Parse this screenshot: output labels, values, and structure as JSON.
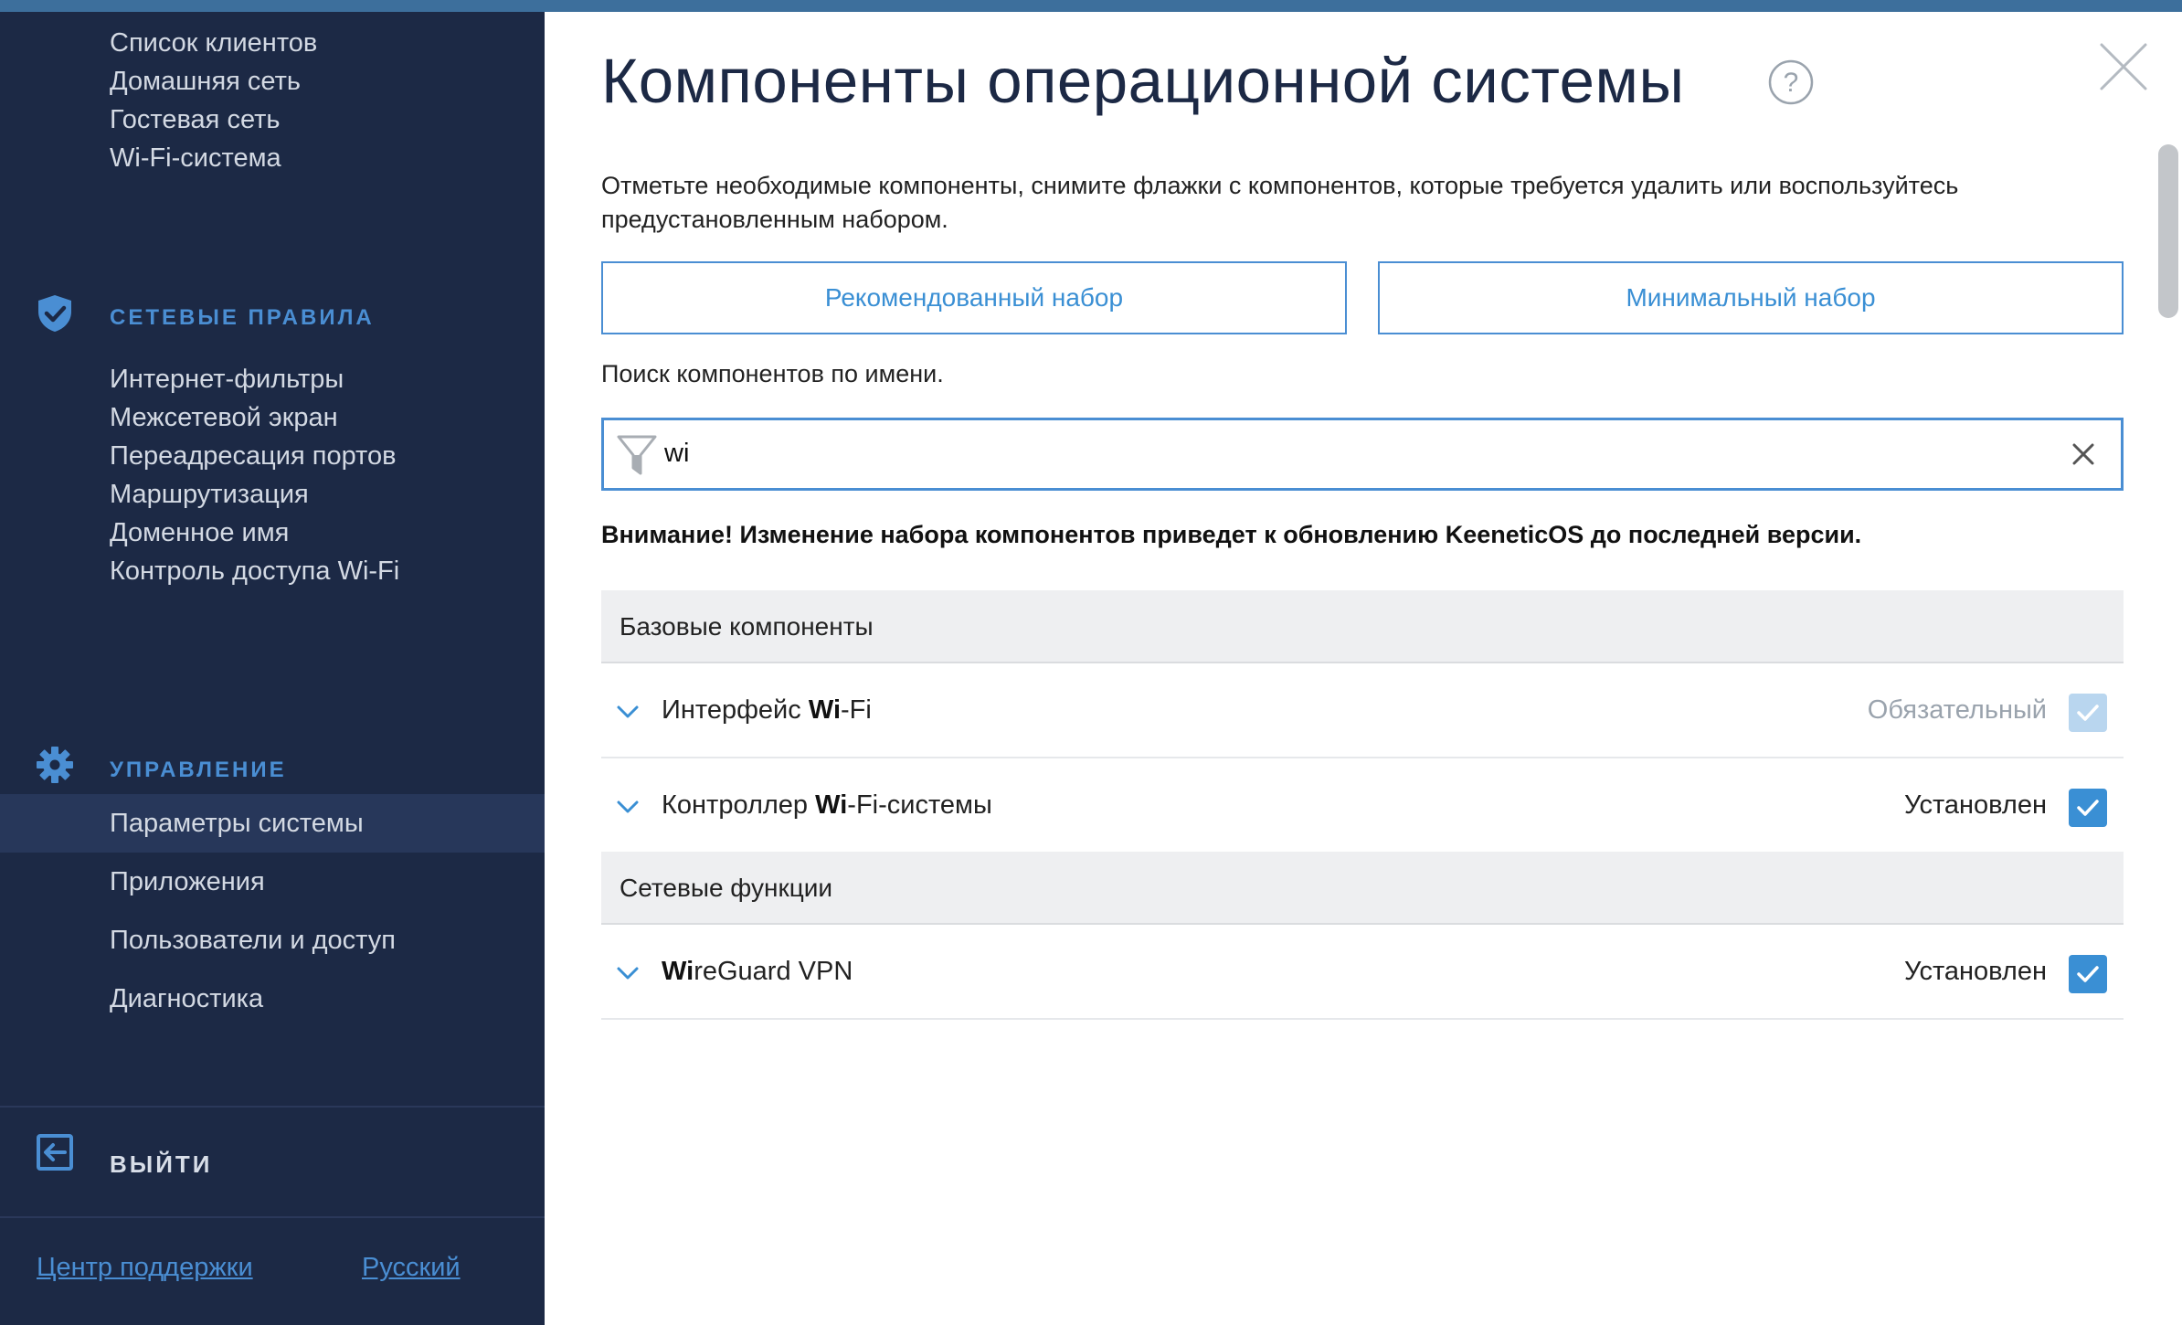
{
  "sidebar": {
    "items_top": [
      "Список клиентов",
      "Домашняя сеть",
      "Гостевая сеть",
      "Wi-Fi-система"
    ],
    "section_network_rules": "СЕТЕВЫЕ ПРАВИЛА",
    "items_rules": [
      "Интернет-фильтры",
      "Межсетевой экран",
      "Переадресация портов",
      "Маршрутизация",
      "Доменное имя",
      "Контроль доступа Wi-Fi"
    ],
    "section_management": "УПРАВЛЕНИЕ",
    "items_management": [
      "Параметры системы",
      "Приложения",
      "Пользователи и доступ",
      "Диагностика"
    ],
    "active_item": "Параметры системы",
    "logout": "ВЫЙТИ",
    "support_link": "Центр поддержки",
    "language_link": "Русский"
  },
  "main": {
    "title": "Компоненты операционной системы",
    "description": "Отметьте необходимые компоненты, снимите флажки с компонентов, которые требуется удалить или воспользуйтесь предустановленным набором.",
    "btn_recommended": "Рекомендованный набор",
    "btn_minimal": "Минимальный набор",
    "search_label": "Поиск компонентов по имени.",
    "search_value": "wi",
    "warning": "Внимание! Изменение набора компонентов приведет к обновлению KeeneticOS до последней версии.",
    "groups": [
      {
        "name": "Базовые компоненты",
        "rows": [
          {
            "pre": "Интерфейс ",
            "match": "Wi",
            "post": "-Fi",
            "status": "Обязательный",
            "checked": true,
            "disabled": true
          },
          {
            "pre": "Контроллер ",
            "match": "Wi",
            "post": "-Fi-системы",
            "status": "Установлен",
            "checked": true,
            "disabled": false
          }
        ]
      },
      {
        "name": "Сетевые функции",
        "rows": [
          {
            "pre": "",
            "match": "Wi",
            "post": "reGuard VPN",
            "status": "Установлен",
            "checked": true,
            "disabled": false
          }
        ]
      }
    ]
  },
  "colors": {
    "sidebar_bg": "#1c2945",
    "accent": "#4a8ed3",
    "checkbox": "#3a8fd4",
    "topbar": "#3d6f9c"
  },
  "icons": {
    "shield": "shield-icon",
    "gear": "gear-icon",
    "logout": "logout-icon",
    "help": "help-icon",
    "close": "close-icon",
    "filter": "filter-icon",
    "chevron": "chevron-down-icon",
    "check": "check-icon"
  }
}
